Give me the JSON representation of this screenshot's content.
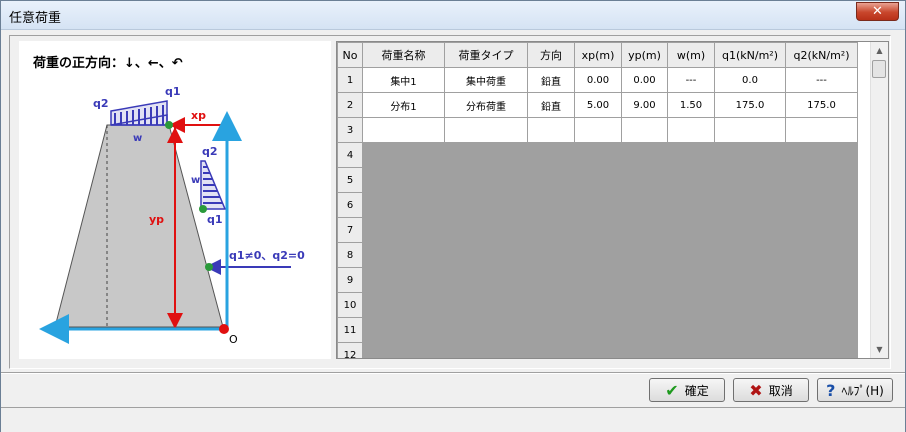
{
  "window": {
    "title": "任意荷重",
    "close_glyph": "✕"
  },
  "figure": {
    "caption": "荷重の正方向：↓、←、↶",
    "labels": {
      "q2_top": "q2",
      "q1_top": "q1",
      "w_top": "w",
      "xp": "xp",
      "yp": "yp",
      "q2_side": "q2",
      "w_side": "w",
      "q1_side": "q1",
      "cond": "q1≠0、q2=0",
      "origin": "O"
    },
    "colors": {
      "load": "#3a3ab8",
      "dim": "#e01010",
      "axis": "#29a3e0",
      "body": "#c8c8c8",
      "node": "#2a9a3a"
    }
  },
  "grid": {
    "columns": [
      "No",
      "荷重名称",
      "荷重タイプ",
      "方向",
      "xp(m)",
      "yp(m)",
      "w(m)",
      "q1(kN/m²)",
      "q2(kN/m²)"
    ],
    "rows": [
      {
        "no": "1",
        "cells": [
          "集中1",
          "集中荷重",
          "鉛直",
          "0.00",
          "0.00",
          "---",
          "0.0",
          "---"
        ]
      },
      {
        "no": "2",
        "cells": [
          "分布1",
          "分布荷重",
          "鉛直",
          "5.00",
          "9.00",
          "1.50",
          "175.0",
          "175.0"
        ]
      },
      {
        "no": "3",
        "cells": [
          "",
          "",
          "",
          "",
          "",
          "",
          "",
          ""
        ]
      },
      {
        "no": "4",
        "cells": [
          "",
          "",
          "",
          "",
          "",
          "",
          "",
          ""
        ]
      },
      {
        "no": "5",
        "cells": [
          "",
          "",
          "",
          "",
          "",
          "",
          "",
          ""
        ]
      },
      {
        "no": "6",
        "cells": [
          "",
          "",
          "",
          "",
          "",
          "",
          "",
          ""
        ]
      },
      {
        "no": "7",
        "cells": [
          "",
          "",
          "",
          "",
          "",
          "",
          "",
          ""
        ]
      },
      {
        "no": "8",
        "cells": [
          "",
          "",
          "",
          "",
          "",
          "",
          "",
          ""
        ]
      },
      {
        "no": "9",
        "cells": [
          "",
          "",
          "",
          "",
          "",
          "",
          "",
          ""
        ]
      },
      {
        "no": "10",
        "cells": [
          "",
          "",
          "",
          "",
          "",
          "",
          "",
          ""
        ]
      },
      {
        "no": "11",
        "cells": [
          "",
          "",
          "",
          "",
          "",
          "",
          "",
          ""
        ]
      },
      {
        "no": "12",
        "cells": [
          "",
          "",
          "",
          "",
          "",
          "",
          "",
          ""
        ]
      }
    ],
    "active_rows": 3
  },
  "buttons": {
    "ok": {
      "label": "確定",
      "icon": "check-icon"
    },
    "cancel": {
      "label": "取消",
      "icon": "x-icon"
    },
    "help": {
      "label": "ﾍﾙﾌﾟ(H)",
      "icon": "question-icon"
    }
  }
}
